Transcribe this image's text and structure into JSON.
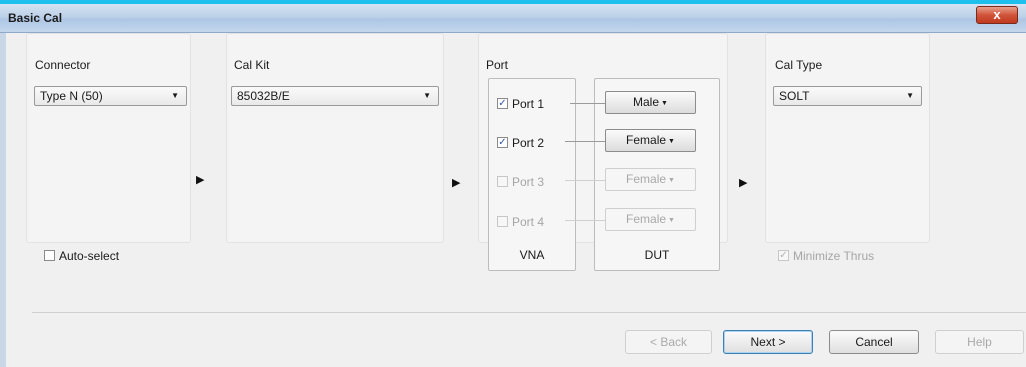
{
  "window": {
    "title": "Basic Cal",
    "close_label": "x"
  },
  "connector": {
    "label": "Connector",
    "value": "Type N (50)",
    "auto_select_label": "Auto-select",
    "auto_select_checked": false
  },
  "cal_kit": {
    "label": "Cal Kit",
    "value": "85032B/E"
  },
  "port": {
    "label": "Port",
    "vna_caption": "VNA",
    "dut_caption": "DUT",
    "ports": [
      {
        "name": "Port 1",
        "checked": true,
        "enabled": true,
        "gender": "Male"
      },
      {
        "name": "Port 2",
        "checked": true,
        "enabled": true,
        "gender": "Female"
      },
      {
        "name": "Port 3",
        "checked": false,
        "enabled": false,
        "gender": "Female"
      },
      {
        "name": "Port 4",
        "checked": false,
        "enabled": false,
        "gender": "Female"
      }
    ]
  },
  "cal_type": {
    "label": "Cal Type",
    "value": "SOLT",
    "minimize_thrus_label": "Minimize Thrus",
    "minimize_thrus_checked": true,
    "minimize_thrus_enabled": false
  },
  "footer": {
    "back": "< Back",
    "next": "Next >",
    "cancel": "Cancel",
    "help": "Help"
  },
  "icons": {
    "dropdown": "chevron-down-icon",
    "step_arrow": "triangle-right-icon",
    "check": "checkmark-icon"
  },
  "colors": {
    "title_accent": "#1dc0ec",
    "close_button": "#c8472b",
    "default_button_border": "#3c7fb1"
  }
}
